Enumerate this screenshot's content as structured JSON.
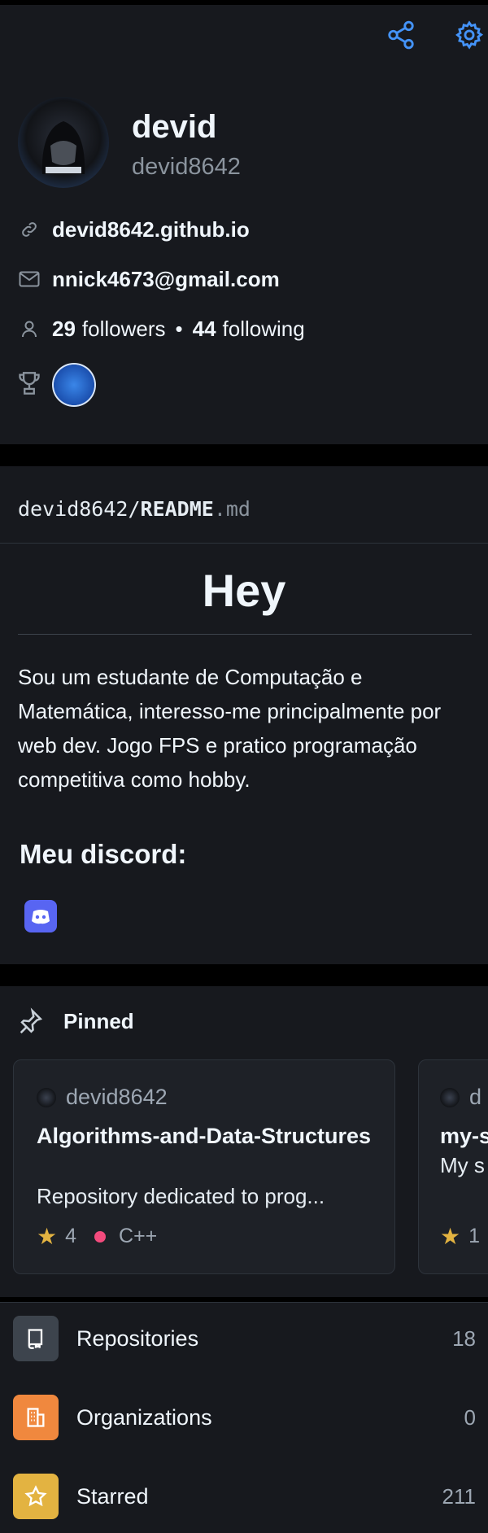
{
  "profile": {
    "name": "devid",
    "login": "devid8642",
    "website": "devid8642.github.io",
    "email": "nnick4673@gmail.com",
    "followers_count": "29",
    "followers_label": "followers",
    "separator": "•",
    "following_count": "44",
    "following_label": "following"
  },
  "readme": {
    "path_user": "devid8642/",
    "path_file": "README",
    "path_ext": ".md",
    "heading": "Hey",
    "bio": "Sou um estudante de Computação e Matemática, interesso-me principalmente por web dev. Jogo FPS e pratico programação competitiva como hobby.",
    "discord_heading": "Meu discord:"
  },
  "pinned": {
    "title": "Pinned",
    "cards": [
      {
        "owner": "devid8642",
        "repo": "Algorithms-and-Data-Structures",
        "description": "Repository dedicated to prog...",
        "stars": "4",
        "language": "C++",
        "language_color": "#f34b7d"
      },
      {
        "owner": "d",
        "repo": "my-s",
        "description": "My s",
        "stars": "1"
      }
    ]
  },
  "lists": [
    {
      "label": "Repositories",
      "count": "18",
      "color": "#3d444d",
      "icon": "repo-icon"
    },
    {
      "label": "Organizations",
      "count": "0",
      "color": "#f0883e",
      "icon": "organization-icon"
    },
    {
      "label": "Starred",
      "count": "211",
      "color": "#e3b341",
      "icon": "star-icon"
    }
  ],
  "colors": {
    "accent": "#4493f8",
    "background": "#17191e",
    "card": "#1e2127"
  }
}
